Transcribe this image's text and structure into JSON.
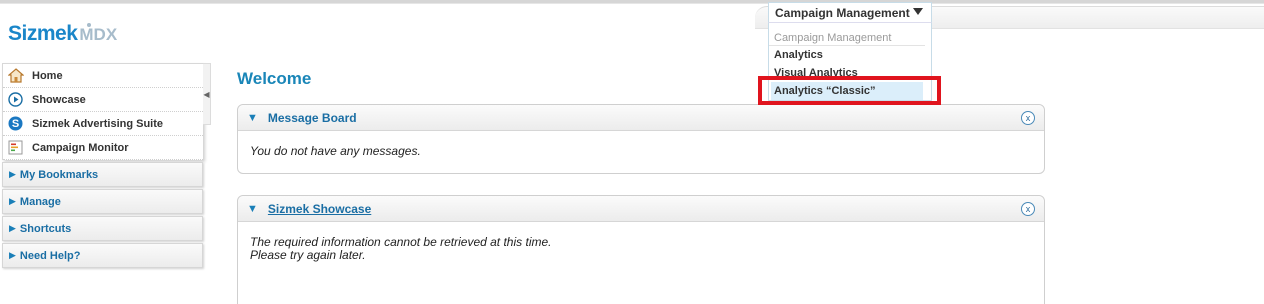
{
  "logo": {
    "brand": "Sizmek",
    "product": "MDX"
  },
  "sidebar": {
    "items": [
      {
        "label": "Home",
        "icon": "home-icon"
      },
      {
        "label": "Showcase",
        "icon": "play-circle-icon"
      },
      {
        "label": "Sizmek Advertising Suite",
        "icon": "sizmek-s-icon"
      },
      {
        "label": "Campaign Monitor",
        "icon": "monitor-list-icon"
      }
    ],
    "sections": [
      {
        "label": "My Bookmarks"
      },
      {
        "label": "Manage"
      },
      {
        "label": "Shortcuts"
      },
      {
        "label": "Need Help?"
      }
    ]
  },
  "main": {
    "title": "Welcome",
    "panels": [
      {
        "title": "Message Board",
        "close": "x",
        "body": [
          "You do not have any messages."
        ]
      },
      {
        "title": "Sizmek Showcase",
        "close": "x",
        "body": [
          "The required information cannot be retrieved at this time.",
          "Please try again later."
        ]
      }
    ]
  },
  "app_menu": {
    "selected": "Campaign Management",
    "options": [
      {
        "label": "Campaign Management",
        "state": "disabled"
      },
      {
        "label": "Analytics"
      },
      {
        "label": "Visual Analytics"
      },
      {
        "label": "Analytics “Classic”",
        "state": "highlighted"
      }
    ]
  },
  "colors": {
    "accent": "#1a86c9",
    "highlight": "#e0141e",
    "link": "#1a6ea4"
  }
}
